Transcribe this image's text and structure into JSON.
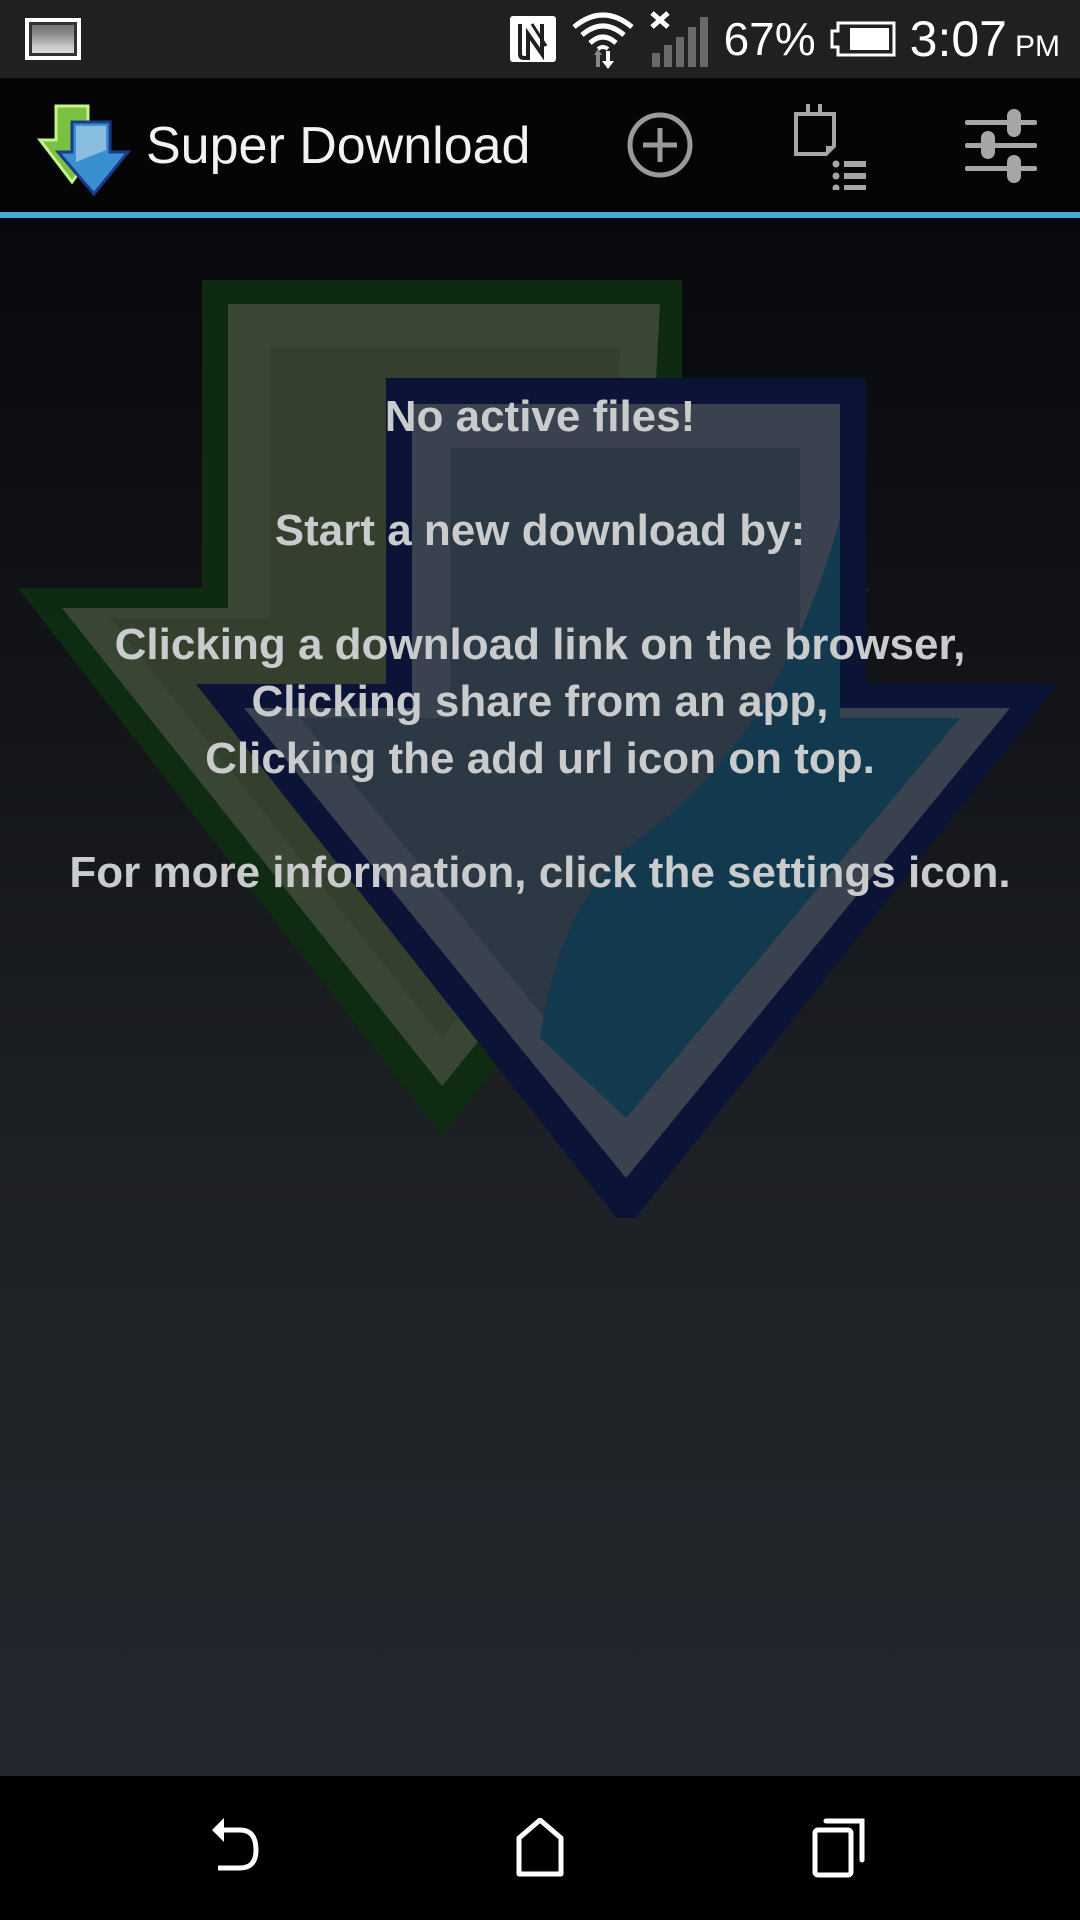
{
  "status_bar": {
    "notification_icon": "gallery-icon",
    "nfc_icon": "nfc-icon",
    "wifi_icon": "wifi-icon",
    "signal_icon": "signal-no-service-icon",
    "battery_percent": "67%",
    "battery_icon": "battery-icon",
    "time": "3:07",
    "ampm": "PM"
  },
  "action_bar": {
    "app_icon": "super-download-logo",
    "title": "Super Download",
    "actions": [
      {
        "name": "add-url",
        "icon": "add-circle-icon"
      },
      {
        "name": "schedule-list",
        "icon": "calendar-list-icon"
      },
      {
        "name": "settings",
        "icon": "sliders-icon"
      }
    ],
    "accent_color": "#4aa8d8"
  },
  "empty_state": {
    "title": "No active files!",
    "intro": "Start a new download by:",
    "methods": [
      "Clicking a download link on the browser,",
      "Clicking share from an app,",
      "Clicking the add url icon on top."
    ],
    "footer": "For more information, click the settings icon."
  },
  "nav_bar": {
    "buttons": [
      {
        "name": "back",
        "icon": "back-icon"
      },
      {
        "name": "home",
        "icon": "home-icon"
      },
      {
        "name": "recents",
        "icon": "recent-apps-icon"
      }
    ]
  }
}
